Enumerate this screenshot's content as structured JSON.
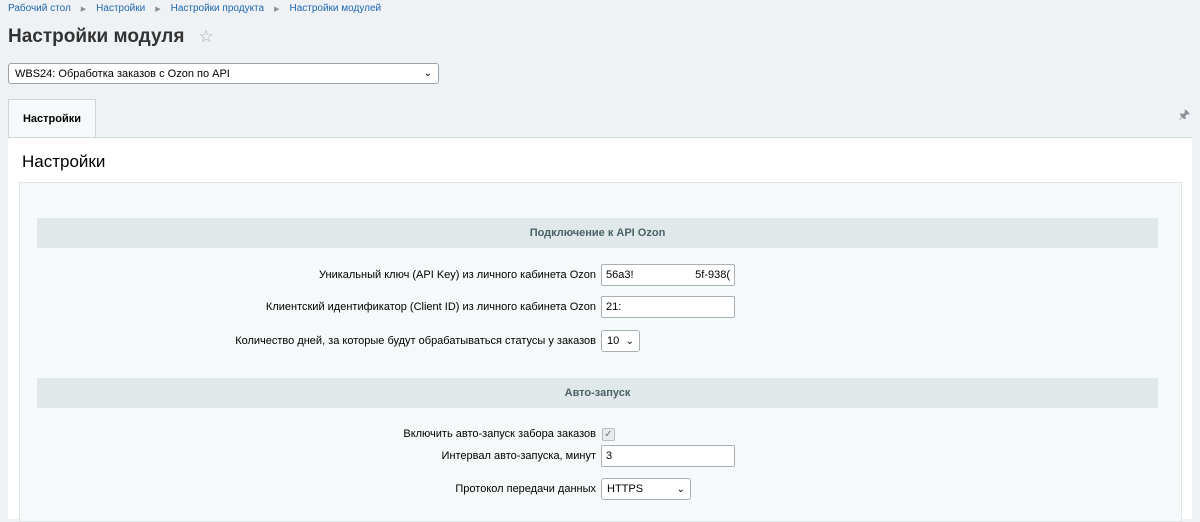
{
  "breadcrumb": {
    "items": [
      "Рабочий стол",
      "Настройки",
      "Настройки продукта",
      "Настройки модулей"
    ],
    "separator": "▶"
  },
  "page": {
    "title": "Настройки модуля",
    "star_icon": "☆"
  },
  "module_select": {
    "value": "WBS24: Обработка заказов с Ozon по API"
  },
  "tabs": [
    {
      "label": "Настройки",
      "active": true
    }
  ],
  "pin_icon": "🖈",
  "panel": {
    "title": "Настройки"
  },
  "sections": {
    "api": {
      "header": "Подключение к API Ozon",
      "fields": {
        "api_key": {
          "label": "Уникальный ключ (API Key) из личного кабинета Ozon",
          "value_start": "56a3!",
          "value_end": "5f-938("
        },
        "client_id": {
          "label": "Клиентский идентификатор (Client ID) из личного кабинета Ozon",
          "value": "21:"
        },
        "days": {
          "label": "Количество дней, за которые будут обрабатываться статусы у заказов",
          "value": "10"
        }
      }
    },
    "autorun": {
      "header": "Авто-запуск",
      "fields": {
        "enable": {
          "label": "Включить авто-запуск забора заказов",
          "checked": true,
          "check_glyph": "✓"
        },
        "interval": {
          "label": "Интервал авто-запуска, минут",
          "value": "3"
        },
        "protocol": {
          "label": "Протокол передачи данных",
          "value": "HTTPS"
        }
      }
    }
  },
  "chevron_glyph": "⌄"
}
